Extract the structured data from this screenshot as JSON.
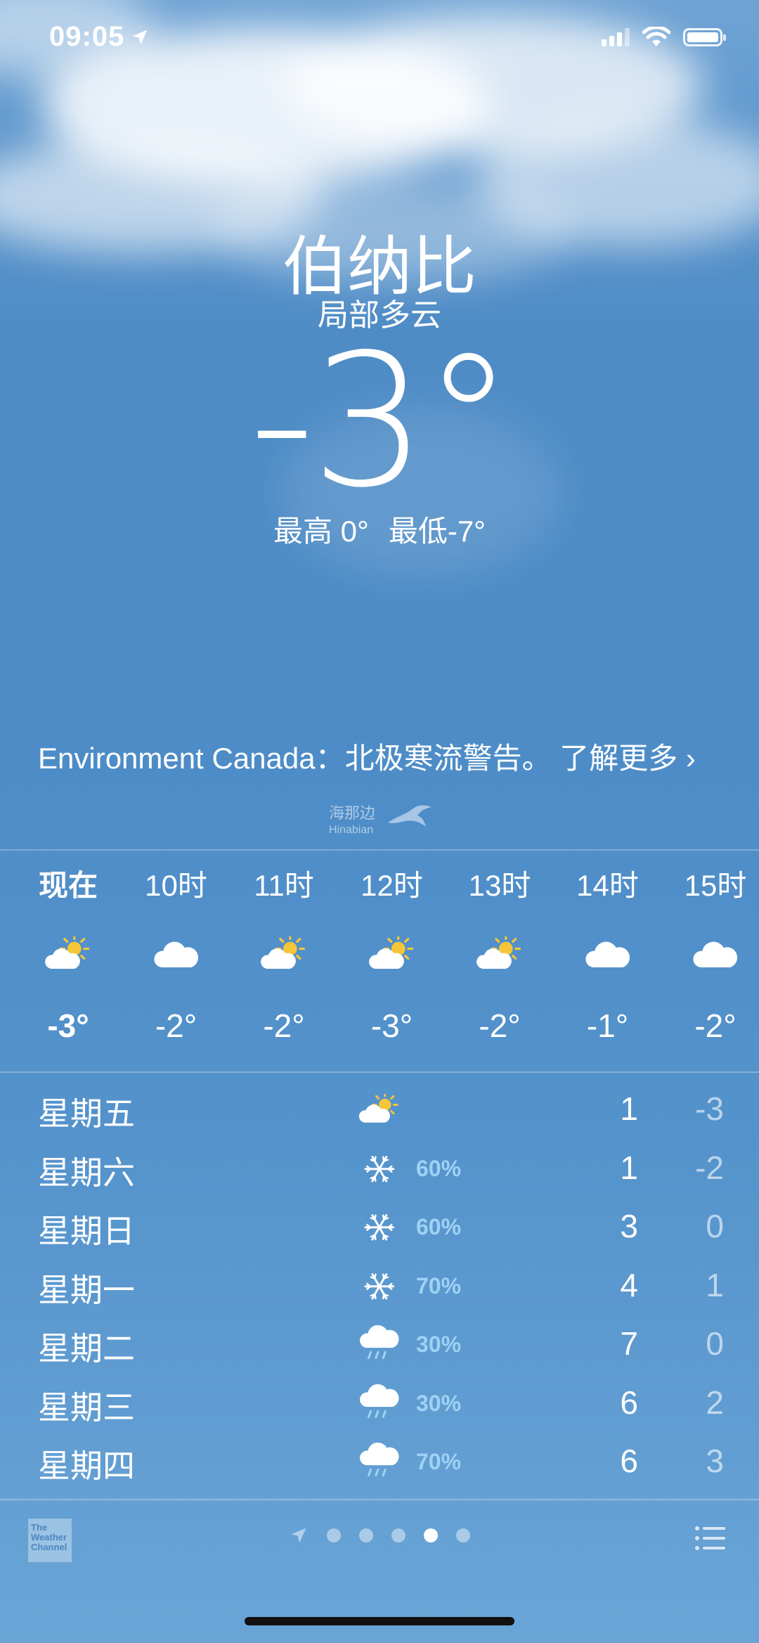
{
  "status_bar": {
    "time": "09:05"
  },
  "location": {
    "city": "伯纳比",
    "condition": "局部多云",
    "temperature": "-3°",
    "high": "最高 0°",
    "low": "最低-7°"
  },
  "alert": {
    "text": "Environment Canada：北极寒流警告。 了解更多 ›"
  },
  "watermark": {
    "cn": "海那边",
    "en": "Hinabian"
  },
  "hourly": [
    {
      "time": "现在",
      "icon": "partly-sunny-icon",
      "temp": "-3°"
    },
    {
      "time": "10时",
      "icon": "cloud-icon",
      "temp": "-2°"
    },
    {
      "time": "11时",
      "icon": "partly-sunny-icon",
      "temp": "-2°"
    },
    {
      "time": "12时",
      "icon": "partly-sunny-icon",
      "temp": "-3°"
    },
    {
      "time": "13时",
      "icon": "partly-sunny-icon",
      "temp": "-2°"
    },
    {
      "time": "14时",
      "icon": "cloud-icon",
      "temp": "-1°"
    },
    {
      "time": "15时",
      "icon": "cloud-icon",
      "temp": "-2°"
    }
  ],
  "daily": [
    {
      "day": "星期五",
      "icon": "partly-sunny-icon",
      "pop": "",
      "high": "1",
      "low": "-3"
    },
    {
      "day": "星期六",
      "icon": "snowflake-icon",
      "pop": "60%",
      "high": "1",
      "low": "-2"
    },
    {
      "day": "星期日",
      "icon": "snowflake-icon",
      "pop": "60%",
      "high": "3",
      "low": "0"
    },
    {
      "day": "星期一",
      "icon": "snowflake-icon",
      "pop": "70%",
      "high": "4",
      "low": "1"
    },
    {
      "day": "星期二",
      "icon": "rain-cloud-icon",
      "pop": "30%",
      "high": "7",
      "low": "0"
    },
    {
      "day": "星期三",
      "icon": "rain-cloud-icon",
      "pop": "30%",
      "high": "6",
      "low": "2"
    },
    {
      "day": "星期四",
      "icon": "rain-cloud-icon",
      "pop": "70%",
      "high": "6",
      "low": "3"
    }
  ],
  "footer": {
    "logo_text": "The Weather Channel",
    "page_count": 5,
    "active_page": 4
  },
  "colors": {
    "sun": "#f5c53a",
    "precip": "#9fd2f3",
    "sky": "#4f8cc6"
  }
}
